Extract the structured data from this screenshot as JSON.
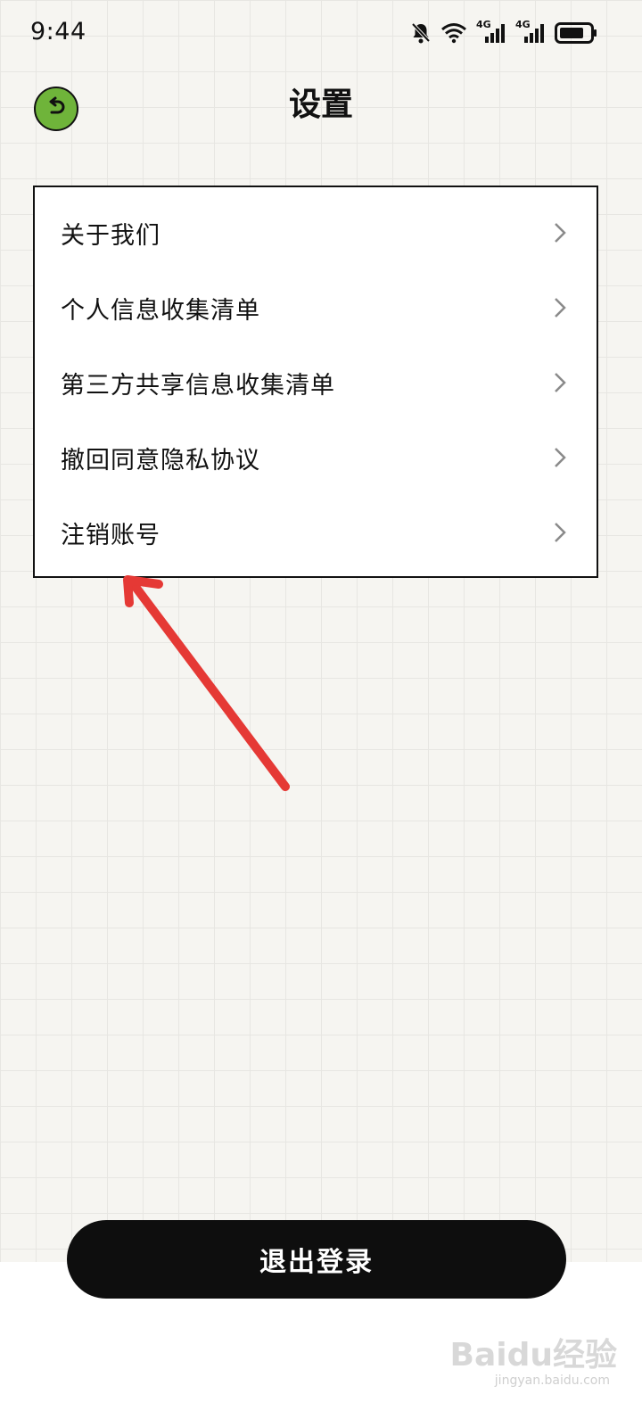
{
  "status_bar": {
    "time": "9:44",
    "icons": [
      "bell-muted-icon",
      "wifi-icon",
      "signal-4g-icon",
      "signal-4g-icon",
      "battery-icon"
    ],
    "network_label_1": "4G",
    "network_label_2": "4G"
  },
  "header": {
    "title": "设置",
    "back_icon": "back-arrow-icon",
    "back_color": "#6fb43a"
  },
  "menu": {
    "items": [
      {
        "label": "关于我们"
      },
      {
        "label": "个人信息收集清单"
      },
      {
        "label": "第三方共享信息收集清单"
      },
      {
        "label": "撤回同意隐私协议"
      },
      {
        "label": "注销账号"
      }
    ]
  },
  "logout": {
    "label": "退出登录"
  },
  "annotation": {
    "arrow_color": "#e53935"
  },
  "watermark": {
    "text": "Baidu经验",
    "sub": "jingyan.baidu.com"
  }
}
